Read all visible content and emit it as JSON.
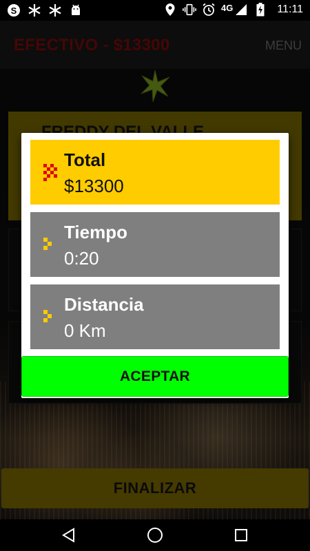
{
  "status_bar": {
    "network_label": "4G",
    "time": "11:11",
    "left_icons": [
      "skype-icon",
      "asterisk-icon",
      "asterisk-icon",
      "android-icon"
    ],
    "right_icons": [
      "location-icon",
      "vibrate-icon",
      "alarm-icon",
      "signal-icon",
      "battery-charging-icon"
    ]
  },
  "app_bar": {
    "title": "EFECTIVO - $13300",
    "menu_label": "MENU"
  },
  "background": {
    "driver_name": "FREDDY DEL VALLE",
    "finalizar_label": "FINALIZAR"
  },
  "dialog": {
    "total": {
      "label": "Total",
      "value": "$13300"
    },
    "tiempo": {
      "label": "Tiempo",
      "value": "0:20"
    },
    "distancia": {
      "label": "Distancia",
      "value": "0 Km"
    },
    "accept_label": "ACEPTAR"
  },
  "colors": {
    "total_card": "#ffcc00",
    "grey_card": "#7f7f7f",
    "accept": "#00ff00",
    "title_red": "#6a0a0a"
  },
  "nav_bar": {
    "icons": [
      "back-icon",
      "home-icon",
      "recents-icon"
    ]
  }
}
